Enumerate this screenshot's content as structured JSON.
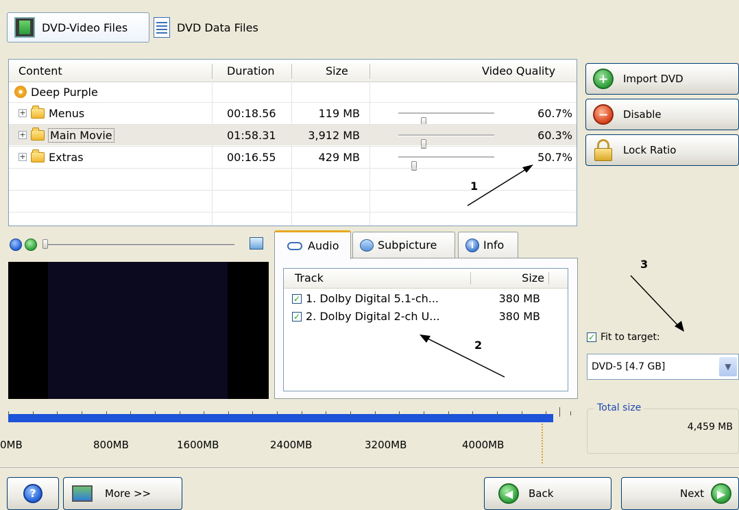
{
  "top_tabs": {
    "video_files": "DVD-Video Files",
    "data_files": "DVD Data Files"
  },
  "content_table": {
    "headers": {
      "content": "Content",
      "duration": "Duration",
      "size": "Size",
      "video_quality": "Video Quality"
    },
    "root": "Deep Purple",
    "rows": [
      {
        "name": "Menus",
        "duration": "00:18.56",
        "size": "119 MB",
        "quality": "60.7%",
        "level": 0.607
      },
      {
        "name": "Main Movie",
        "duration": "01:58.31",
        "size": "3,912 MB",
        "quality": "60.3%",
        "level": 0.603
      },
      {
        "name": "Extras",
        "duration": "00:16.55",
        "size": "429 MB",
        "quality": "50.7%",
        "level": 0.507
      }
    ]
  },
  "right_buttons": {
    "import": "Import DVD",
    "disable": "Disable",
    "lock_ratio": "Lock Ratio"
  },
  "player": {
    "position_fraction": 0.0
  },
  "panel_tabs": {
    "audio": "Audio",
    "subpicture": "Subpicture",
    "info": "Info"
  },
  "audio_list": {
    "headers": {
      "track": "Track",
      "size": "Size"
    },
    "tracks": [
      {
        "name": "1. Dolby Digital 5.1-ch...",
        "size": "380 MB",
        "checked": true
      },
      {
        "name": "2. Dolby Digital 2-ch U...",
        "size": "380 MB",
        "checked": true
      }
    ]
  },
  "annotations": {
    "one": "1",
    "two": "2",
    "three": "3"
  },
  "target": {
    "fit_label": "Fit to target:",
    "fit_checked": true,
    "selected": "DVD-5 [4.7 GB]"
  },
  "total": {
    "label": "Total size",
    "value": "4,459 MB"
  },
  "size_scale": {
    "labels": [
      "0MB",
      "800MB",
      "1600MB",
      "2400MB",
      "3200MB",
      "4000MB"
    ],
    "used_mb": 4459,
    "max_mb": 4600
  },
  "bottom_buttons": {
    "more": "More >>",
    "back": "Back",
    "next": "Next"
  },
  "colors": {
    "accent_blue": "#1c53d8",
    "ok_green": "#2f9e3a",
    "stop_red": "#d8401c"
  }
}
